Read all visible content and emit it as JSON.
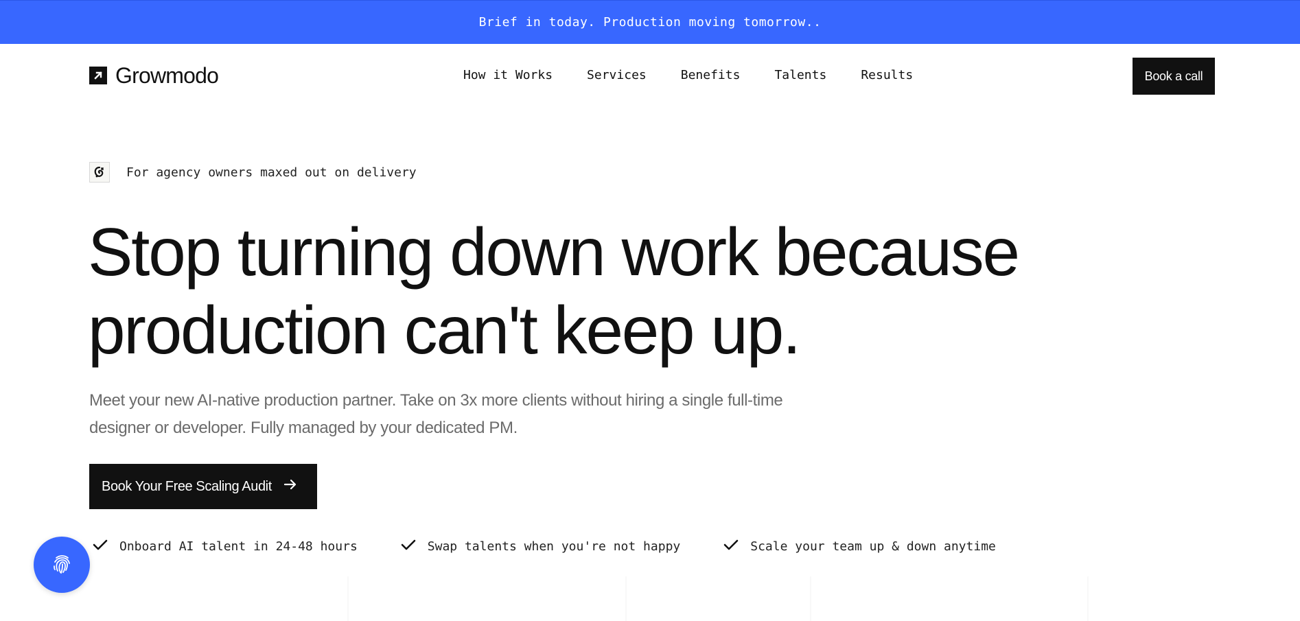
{
  "announcement": {
    "text": "Brief in today. Production moving tomorrow.."
  },
  "header": {
    "logo_text": "Growmodo",
    "logo_icon": "arrow-up-right-icon",
    "nav": [
      {
        "label": "How it Works"
      },
      {
        "label": "Services"
      },
      {
        "label": "Benefits"
      },
      {
        "label": "Talents"
      },
      {
        "label": "Results"
      }
    ],
    "cta_label": "Book a call"
  },
  "hero": {
    "eyebrow_icon": "scribble-badge-icon",
    "eyebrow": "For agency owners maxed out on delivery",
    "headline": "Stop turning down work because production can't keep up.",
    "subcopy": "Meet your new AI-native production partner. Take on 3x more clients without hiring a single full-time designer or developer. Fully managed by your dedicated PM.",
    "cta_label": "Book Your Free Scaling Audit",
    "cta_icon": "arrow-right-icon",
    "benefits": [
      {
        "icon": "check-icon",
        "text": "Onboard AI talent in 24-48 hours"
      },
      {
        "icon": "check-icon",
        "text": "Swap talents when you're not happy"
      },
      {
        "icon": "check-icon",
        "text": "Scale your team up & down anytime"
      }
    ]
  },
  "widget": {
    "icon": "fingerprint-icon"
  },
  "colors": {
    "accent_blue": "#3867ff",
    "ink": "#111111",
    "muted": "#6b6b6b"
  }
}
